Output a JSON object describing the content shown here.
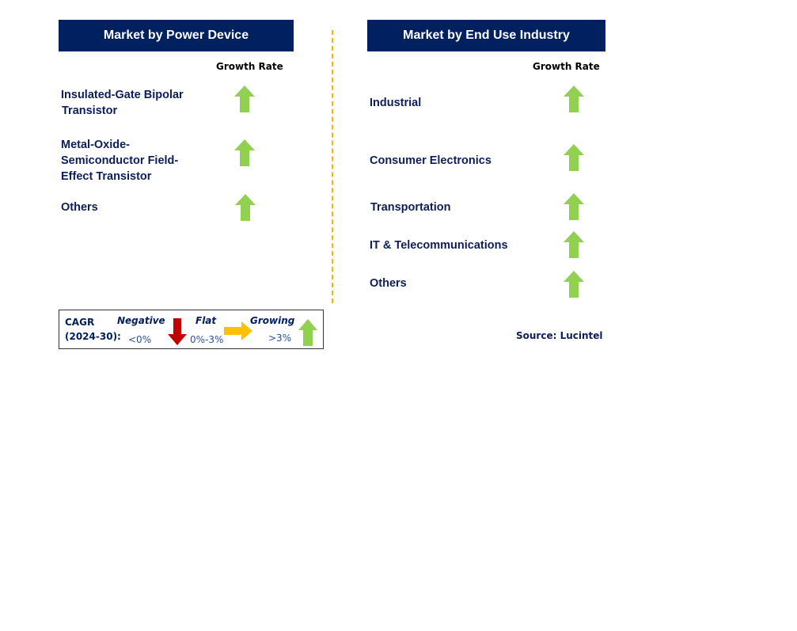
{
  "left_panel": {
    "title": "Market by Power Device",
    "growth_rate_label": "Growth Rate",
    "items": [
      {
        "label_lines": [
          "Insulated-Gate Bipolar",
          "Transistor"
        ],
        "trend": "growing"
      },
      {
        "label_lines": [
          "Metal-Oxide-",
          "Semiconductor Field-",
          "Effect Transistor"
        ],
        "trend": "growing"
      },
      {
        "label_lines": [
          "Others"
        ],
        "trend": "growing"
      }
    ]
  },
  "right_panel": {
    "title": "Market by End Use Industry",
    "growth_rate_label": "Growth Rate",
    "items": [
      {
        "label": "Industrial",
        "trend": "growing"
      },
      {
        "label": "Consumer Electronics",
        "trend": "growing"
      },
      {
        "label": "Transportation",
        "trend": "growing"
      },
      {
        "label": "IT & Telecommunications",
        "trend": "growing"
      },
      {
        "label": "Others",
        "trend": "growing"
      }
    ]
  },
  "legend": {
    "cagr_line1": "CAGR",
    "cagr_line2": "(2024-30):",
    "negative": {
      "label": "Negative",
      "range": "<0%",
      "icon": "arrow-down-icon",
      "color": "#c00000"
    },
    "flat": {
      "label": "Flat",
      "range": "0%-3%",
      "icon": "arrow-right-icon",
      "color": "#ffc000"
    },
    "growing": {
      "label": "Growing",
      "range": ">3%",
      "icon": "arrow-up-icon",
      "color": "#92d050"
    }
  },
  "source": "Source: Lucintel",
  "colors": {
    "header_bg": "#002060",
    "growing": "#92d050",
    "flat": "#ffc000",
    "negative": "#c00000",
    "divider": "#f5b800"
  }
}
